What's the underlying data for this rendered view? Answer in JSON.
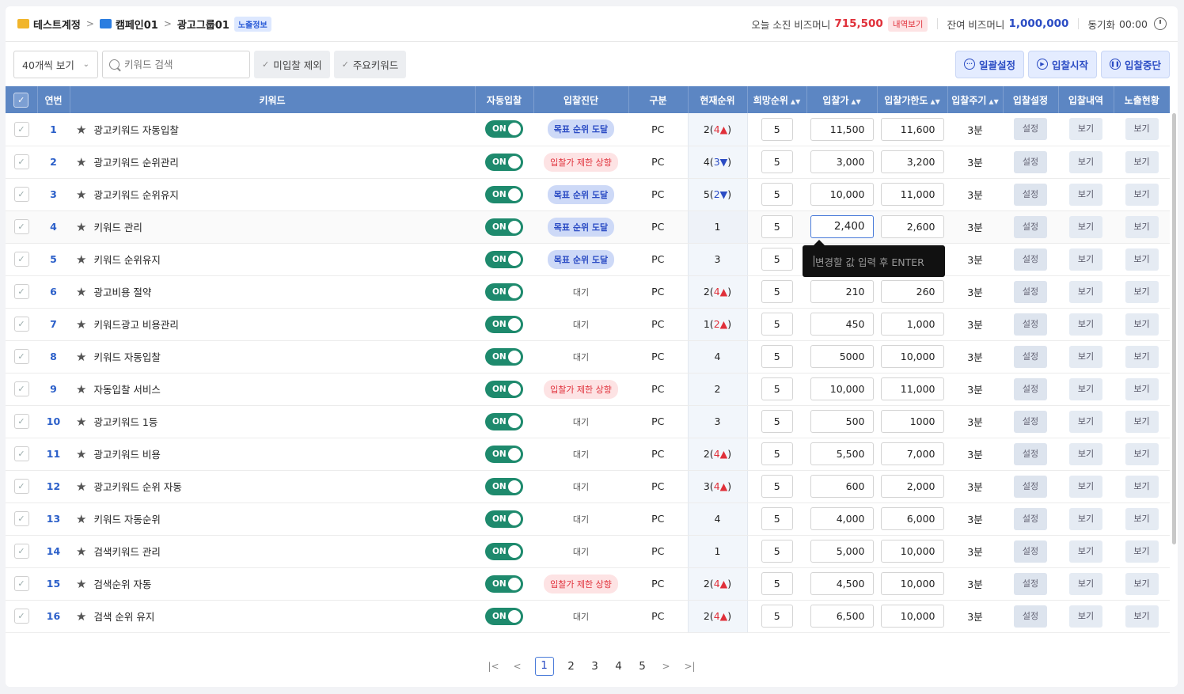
{
  "breadcrumb": {
    "account": "테스트계정",
    "campaign": "캠페인01",
    "group": "광고그룹01",
    "badge": "노출정보"
  },
  "budget": {
    "today_label": "오늘 소진 비즈머니",
    "today_value": "715,500",
    "detail_label": "내역보기",
    "balance_label": "잔여 비즈머니",
    "balance_value": "1,000,000",
    "sync_label": "동기화",
    "sync_time": "00:00"
  },
  "toolbar": {
    "page_size": "40개씩 보기",
    "search_placeholder": "키워드 검색",
    "filter_unbid": "미입찰 제외",
    "filter_main": "주요키워드",
    "bulk": "일괄설정",
    "start": "입찰시작",
    "stop": "입찰중단"
  },
  "colors": {
    "header": "#5c86c3",
    "toggle_on": "#1e8a6d",
    "accent": "#2b4cc4",
    "alert": "#e0303a"
  },
  "columns": [
    "연번",
    "키워드",
    "자동입찰",
    "입찰진단",
    "구분",
    "현재순위",
    "희망순위",
    "입찰가",
    "입찰가한도",
    "입찰주기",
    "입찰설정",
    "입찰내역",
    "노출현황"
  ],
  "labels": {
    "on": "ON",
    "set": "설정",
    "view": "보기"
  },
  "rows": [
    {
      "no": "1",
      "kw": "광고키워드 자동입찰",
      "diag": "목표 순위 도달",
      "dtype": "good",
      "device": "PC",
      "rank": "2",
      "chg": "4",
      "dir": "up",
      "hope": "5",
      "bid": "11,500",
      "limit": "11,600",
      "cycle": "3분"
    },
    {
      "no": "2",
      "kw": "광고키워드 순위관리",
      "diag": "입찰가 제한 상향",
      "dtype": "warn",
      "device": "PC",
      "rank": "4",
      "chg": "3",
      "dir": "dn",
      "hope": "5",
      "bid": "3,000",
      "limit": "3,200",
      "cycle": "3분"
    },
    {
      "no": "3",
      "kw": "광고키워드 순위유지",
      "diag": "목표 순위 도달",
      "dtype": "good",
      "device": "PC",
      "rank": "5",
      "chg": "2",
      "dir": "dn",
      "hope": "5",
      "bid": "10,000",
      "limit": "11,000",
      "cycle": "3분"
    },
    {
      "no": "4",
      "kw": "키워드 관리",
      "diag": "목표 순위 도달",
      "dtype": "good",
      "device": "PC",
      "rank": "1",
      "chg": "",
      "dir": "",
      "hope": "5",
      "bid": "2,400",
      "limit": "2,600",
      "cycle": "3분"
    },
    {
      "no": "5",
      "kw": "키워드 순위유지",
      "diag": "목표 순위 도달",
      "dtype": "good",
      "device": "PC",
      "rank": "3",
      "chg": "",
      "dir": "",
      "hope": "5",
      "bid": "",
      "limit": "",
      "cycle": "3분"
    },
    {
      "no": "6",
      "kw": "광고비용 절약",
      "diag": "대기",
      "dtype": "wait",
      "device": "PC",
      "rank": "2",
      "chg": "4",
      "dir": "up",
      "hope": "5",
      "bid": "210",
      "limit": "260",
      "cycle": "3분"
    },
    {
      "no": "7",
      "kw": "키워드광고 비용관리",
      "diag": "대기",
      "dtype": "wait",
      "device": "PC",
      "rank": "1",
      "chg": "2",
      "dir": "up",
      "hope": "5",
      "bid": "450",
      "limit": "1,000",
      "cycle": "3분"
    },
    {
      "no": "8",
      "kw": "키워드 자동입찰",
      "diag": "대기",
      "dtype": "wait",
      "device": "PC",
      "rank": "4",
      "chg": "",
      "dir": "",
      "hope": "5",
      "bid": "5000",
      "limit": "10,000",
      "cycle": "3분"
    },
    {
      "no": "9",
      "kw": "자동입찰 서비스",
      "diag": "입찰가 제한 상향",
      "dtype": "warn",
      "device": "PC",
      "rank": "2",
      "chg": "",
      "dir": "",
      "hope": "5",
      "bid": "10,000",
      "limit": "11,000",
      "cycle": "3분"
    },
    {
      "no": "10",
      "kw": "광고키워드 1등",
      "diag": "대기",
      "dtype": "wait",
      "device": "PC",
      "rank": "3",
      "chg": "",
      "dir": "",
      "hope": "5",
      "bid": "500",
      "limit": "1000",
      "cycle": "3분"
    },
    {
      "no": "11",
      "kw": "광고키워드 비용",
      "diag": "대기",
      "dtype": "wait",
      "device": "PC",
      "rank": "2",
      "chg": "4",
      "dir": "up",
      "hope": "5",
      "bid": "5,500",
      "limit": "7,000",
      "cycle": "3분"
    },
    {
      "no": "12",
      "kw": "광고키워드 순위 자동",
      "diag": "대기",
      "dtype": "wait",
      "device": "PC",
      "rank": "3",
      "chg": "4",
      "dir": "up",
      "hope": "5",
      "bid": "600",
      "limit": "2,000",
      "cycle": "3분"
    },
    {
      "no": "13",
      "kw": "키워드 자동순위",
      "diag": "대기",
      "dtype": "wait",
      "device": "PC",
      "rank": "4",
      "chg": "",
      "dir": "",
      "hope": "5",
      "bid": "4,000",
      "limit": "6,000",
      "cycle": "3분"
    },
    {
      "no": "14",
      "kw": "검색키워드 관리",
      "diag": "대기",
      "dtype": "wait",
      "device": "PC",
      "rank": "1",
      "chg": "",
      "dir": "",
      "hope": "5",
      "bid": "5,000",
      "limit": "10,000",
      "cycle": "3분"
    },
    {
      "no": "15",
      "kw": "검색순위 자동",
      "diag": "입찰가 제한 상향",
      "dtype": "warn",
      "device": "PC",
      "rank": "2",
      "chg": "4",
      "dir": "up",
      "hope": "5",
      "bid": "4,500",
      "limit": "10,000",
      "cycle": "3분"
    },
    {
      "no": "16",
      "kw": "검색 순위 유지",
      "diag": "대기",
      "dtype": "wait",
      "device": "PC",
      "rank": "2",
      "chg": "4",
      "dir": "up",
      "hope": "5",
      "bid": "6,500",
      "limit": "10,000",
      "cycle": "3분"
    }
  ],
  "tooltip": "변경할 값 입력 후 ENTER",
  "pager": {
    "pages": [
      "1",
      "2",
      "3",
      "4",
      "5"
    ],
    "current": "1"
  }
}
